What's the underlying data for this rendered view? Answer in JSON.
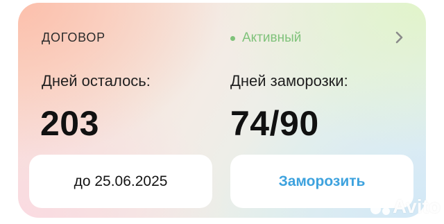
{
  "contract": {
    "label": "ДОГОВОР",
    "status": "Активный",
    "status_color": "#7fc27a"
  },
  "days_left": {
    "caption": "Дней осталось:",
    "value": "203"
  },
  "freeze_days": {
    "caption": "Дней заморозки:",
    "value": "74/90"
  },
  "buttons": {
    "end_date": "до 25.06.2025",
    "freeze": "Заморозить",
    "freeze_color": "#3da2de"
  },
  "watermark": {
    "text": "Avito"
  }
}
